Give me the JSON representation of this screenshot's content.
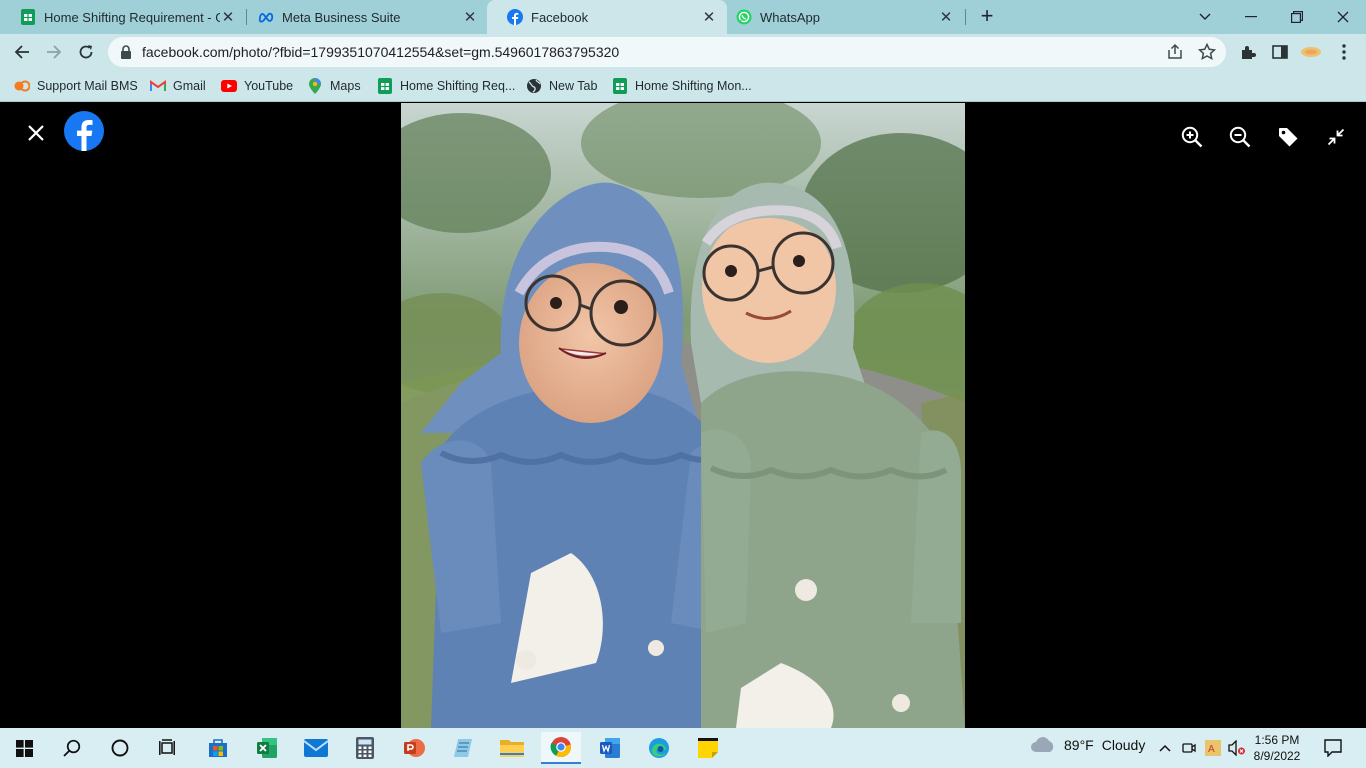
{
  "browser": {
    "tabs": [
      {
        "title": "Home Shifting Requirement - Go",
        "icon": "google-sheets-icon",
        "active": false
      },
      {
        "title": "Meta Business Suite",
        "icon": "meta-icon",
        "active": false
      },
      {
        "title": "Facebook",
        "icon": "facebook-icon",
        "active": true
      },
      {
        "title": "WhatsApp",
        "icon": "whatsapp-icon",
        "active": false
      }
    ],
    "new_tab_label": "+",
    "url": "facebook.com/photo/?fbid=1799351070412554&set=gm.5496017863795320",
    "bookmarks": [
      {
        "label": "Support Mail BMS",
        "icon": "bms-icon"
      },
      {
        "label": "Gmail",
        "icon": "gmail-icon"
      },
      {
        "label": "YouTube",
        "icon": "youtube-icon"
      },
      {
        "label": "Maps",
        "icon": "maps-icon"
      },
      {
        "label": "Home Shifting Req...",
        "icon": "google-sheets-icon"
      },
      {
        "label": "New Tab",
        "icon": "globe-icon"
      },
      {
        "label": "Home Shifting Mon...",
        "icon": "google-sheets-icon"
      }
    ]
  },
  "viewer": {
    "tools": [
      "zoom-in-icon",
      "zoom-out-icon",
      "tag-icon",
      "exit-fullscreen-icon"
    ]
  },
  "taskbar": {
    "apps": [
      "start-icon",
      "search-icon",
      "cortana-icon",
      "task-view-icon",
      "microsoft-store-icon",
      "excel-icon",
      "mail-icon",
      "calculator-icon",
      "powerpoint-icon",
      "notepad-icon",
      "file-explorer-icon",
      "chrome-icon",
      "word-icon",
      "edge-icon",
      "sticky-notes-icon"
    ],
    "weather_temp": "89°F",
    "weather_desc": "Cloudy",
    "time": "1:56 PM",
    "date": "8/9/2022"
  },
  "colors": {
    "tabstrip": "#9fd0d8",
    "toolbar": "#cde6ea",
    "facebook_blue": "#1877f2",
    "taskbar": "#d9eef2"
  }
}
